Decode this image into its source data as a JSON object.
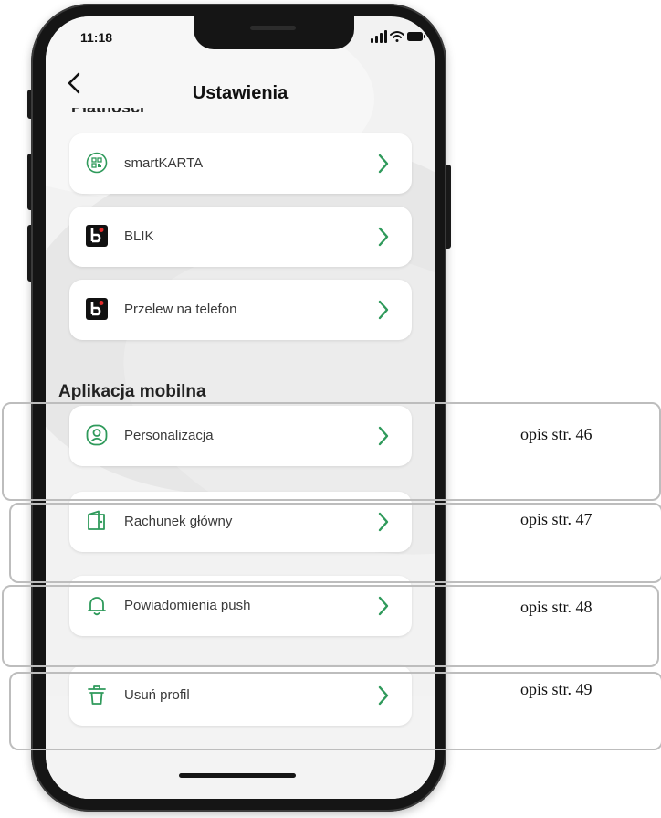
{
  "status_bar": {
    "time": "11:18"
  },
  "nav": {
    "title": "Ustawienia",
    "back_icon": "chevron-left-icon"
  },
  "cut_section_heading": "Płatności",
  "payments": [
    {
      "label": "smartKARTA",
      "icon": "smartkarta-icon"
    },
    {
      "label": "BLIK",
      "icon": "blik-icon"
    },
    {
      "label": "Przelew na telefon",
      "icon": "blik-icon"
    }
  ],
  "mobile_section": {
    "heading": "Aplikacja mobilna",
    "items": [
      {
        "label": "Personalizacja",
        "icon": "user-circle-icon",
        "note": "opis str. 46"
      },
      {
        "label": "Rachunek główny",
        "icon": "wallet-icon",
        "note": "opis str. 47"
      },
      {
        "label": "Powiadomienia push",
        "icon": "bell-icon",
        "note": "opis str. 48"
      },
      {
        "label": "Usuń profil",
        "icon": "trash-icon",
        "note": "opis str. 49"
      }
    ]
  },
  "colors": {
    "accent": "#2f9a5b",
    "blik_bg": "#111111",
    "blik_dot": "#e22a2a"
  }
}
